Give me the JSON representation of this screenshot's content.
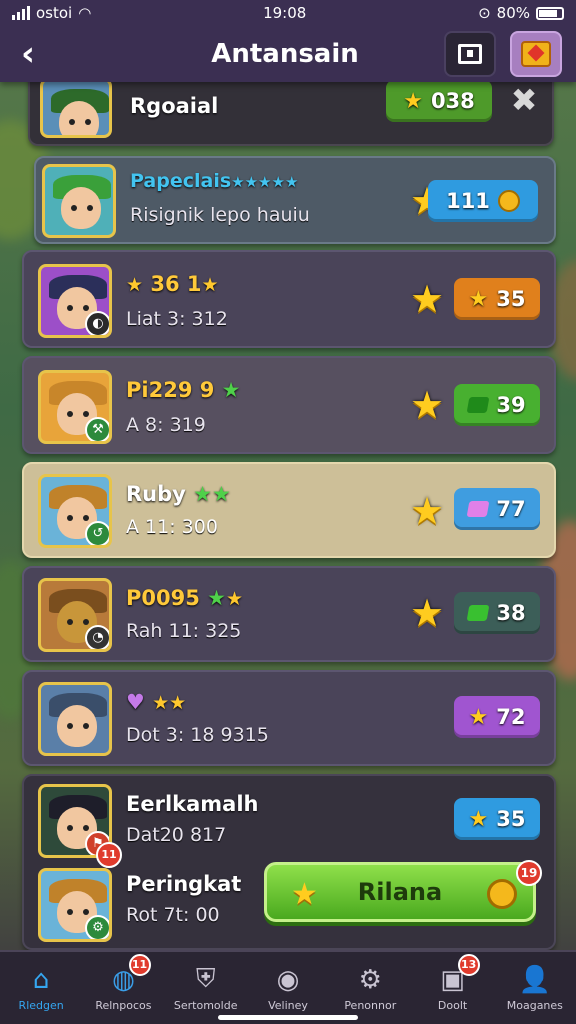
{
  "status": {
    "carrier": "ostoi",
    "time": "19:08",
    "battery": "80%"
  },
  "header": {
    "title": "Antansain",
    "back_icon": "chevron-left-icon",
    "menu_icon": "square-icon",
    "gift_icon": "gift-icon"
  },
  "rows": [
    {
      "name": "Rgoaial",
      "pill_value": "038",
      "pill_color": "#4e9a2a",
      "action_icon": "close-x-icon"
    },
    {
      "name": "Papeclais",
      "name_stars": "★★★★★",
      "sub": "Risignik lepo hauiu",
      "pill_value": "111",
      "pill_color": "#2f9be0"
    },
    {
      "name": "36 1",
      "sub": "Liat 3: 312",
      "pill_value": "35",
      "pill_color": "#e0801c"
    },
    {
      "name": "Pi229 9",
      "sub": "A 8: 319",
      "pill_value": "39",
      "pill_color": "#48b030"
    },
    {
      "name": "Ruby",
      "sub": "A 11: 300",
      "pill_value": "77",
      "pill_color": "#3f9de0"
    },
    {
      "name": "P0095",
      "sub": "Rah 11: 325",
      "pill_value": "38",
      "pill_color": "#3c5e58"
    },
    {
      "name": "",
      "sub": "Dot 3: 18 9315",
      "pill_value": "72",
      "pill_color": "#a055d0"
    },
    {
      "name": "Eerlkamalh",
      "sub": "Dat20 817",
      "pill_value": "35",
      "pill_color": "#2f9be0",
      "badge": "11"
    },
    {
      "name": "Peringkat",
      "sub": "Rot 7t: 00"
    }
  ],
  "claim_button": {
    "label": "Rilana",
    "badge": "19"
  },
  "nav": [
    {
      "label": "Rledgen",
      "icon": "home-icon",
      "active": true
    },
    {
      "label": "Relnpocos",
      "icon": "ball-icon",
      "badge": "11"
    },
    {
      "label": "Sertomolde",
      "icon": "shield-icon"
    },
    {
      "label": "Veliney",
      "icon": "camera-icon"
    },
    {
      "label": "Penonnor",
      "icon": "gear-icon"
    },
    {
      "label": "Doolt",
      "icon": "chat-icon",
      "badge": "13"
    },
    {
      "label": "Moaganes",
      "icon": "user-icon"
    }
  ]
}
